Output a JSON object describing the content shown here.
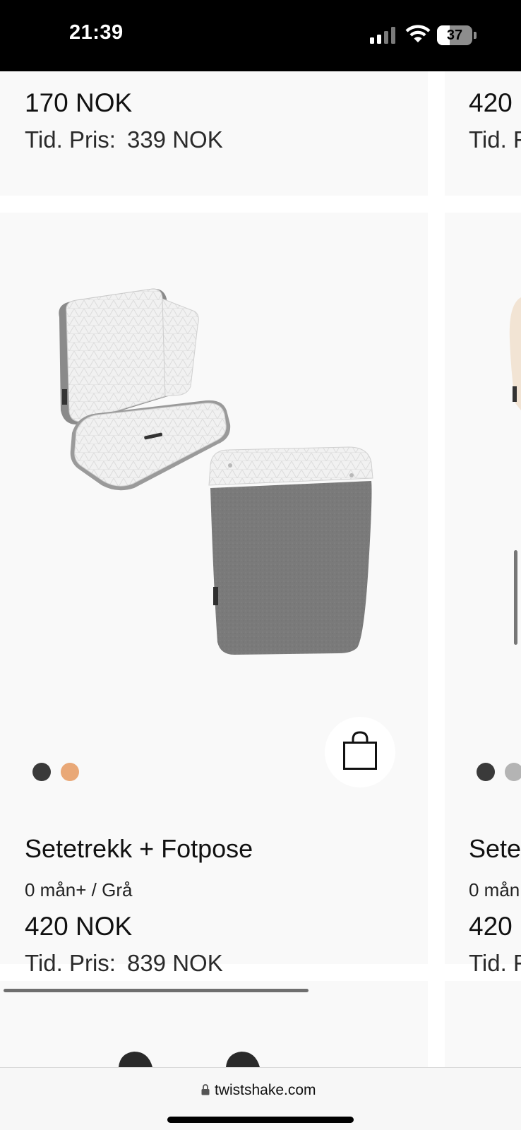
{
  "status_bar": {
    "time": "21:39",
    "battery_level": "37"
  },
  "top_row": {
    "left": {
      "price": "170 NOK",
      "old_price_label": "Tid. Pris:",
      "old_price_value": "339 NOK"
    },
    "right": {
      "price": "420",
      "old_price_label": "Tid. F"
    }
  },
  "product_row": {
    "left": {
      "title": "Setetrekk + Fotpose",
      "variant": "0 mån+ / Grå",
      "price": "420 NOK",
      "old_price_label": "Tid. Pris:",
      "old_price_value": "839 NOK",
      "swatches": [
        "#3a3a3a",
        "#e9a877"
      ],
      "image_alt": "Seat cover and footmuff"
    },
    "right": {
      "title": "Sete",
      "variant": "0 mån",
      "price": "420",
      "old_price_label": "Tid. F",
      "swatches": [
        "#3a3a3a",
        "#b4b4b4"
      ]
    }
  },
  "browser": {
    "url": "twistshake.com"
  },
  "colors": {
    "card_bg": "#f9f9f9",
    "page_bg": "#ffffff"
  }
}
